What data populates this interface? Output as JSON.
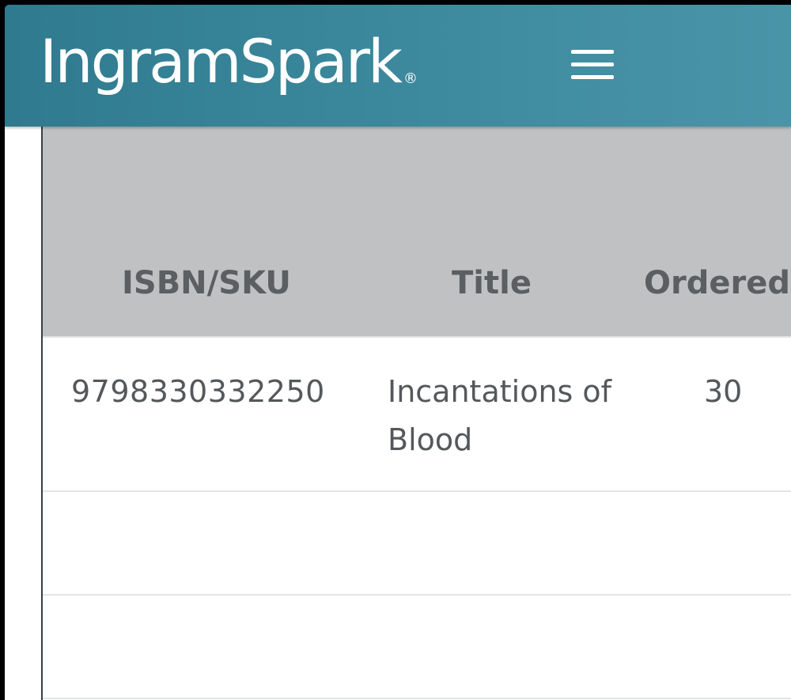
{
  "header": {
    "brand": "IngramSpark",
    "brand_mark": "®",
    "menu_icon": "hamburger-menu-icon",
    "background_color": "#3d8a9e"
  },
  "table": {
    "columns": [
      "ISBN/SKU",
      "Title",
      "Ordered"
    ],
    "rows": [
      {
        "isbn": "9798330332250",
        "title": "Incantations of Blood",
        "ordered": "30"
      },
      {
        "isbn": "",
        "title": "",
        "ordered": ""
      },
      {
        "isbn": "",
        "title": "",
        "ordered": ""
      }
    ],
    "header_background": "#c0c1c3"
  }
}
